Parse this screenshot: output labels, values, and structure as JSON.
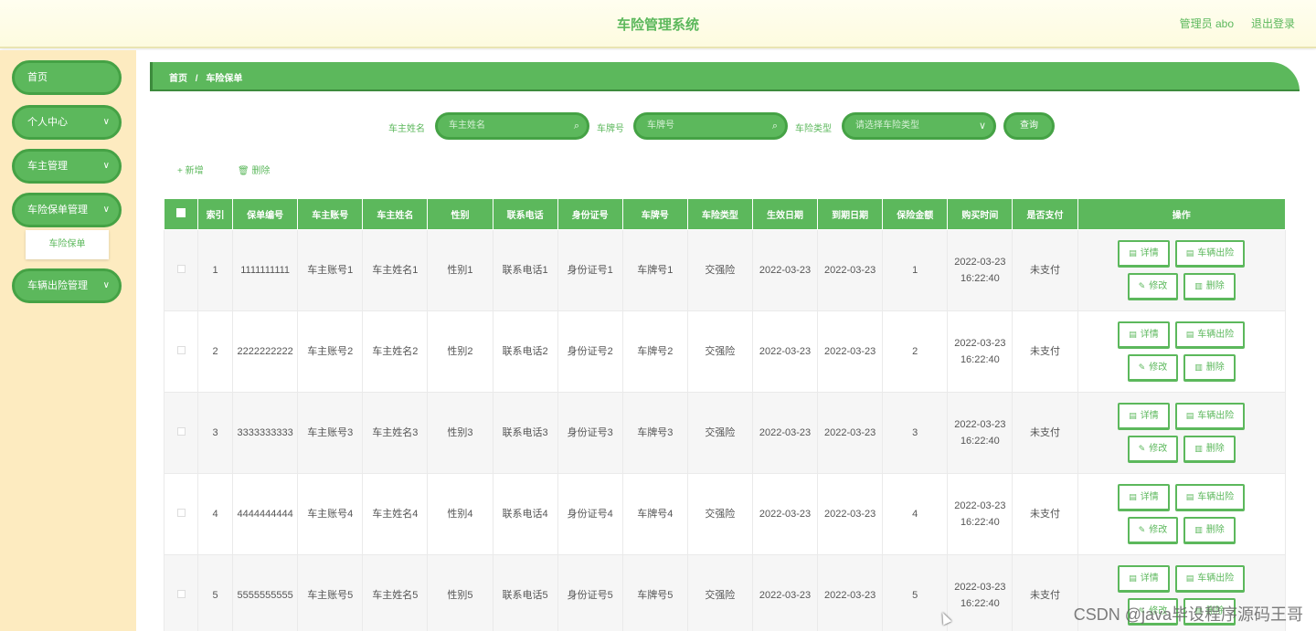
{
  "header": {
    "title": "车险管理系统",
    "admin": "管理员 abo",
    "logout": "退出登录"
  },
  "sidebar": {
    "items": [
      {
        "label": "首页"
      },
      {
        "label": "个人中心"
      },
      {
        "label": "车主管理"
      },
      {
        "label": "车险保单管理"
      },
      {
        "label": "车辆出险管理"
      }
    ],
    "sub_active": "车险保单"
  },
  "breadcrumb": {
    "home": "首页",
    "sep": "/",
    "current": "车险保单"
  },
  "search": {
    "owner_label": "车主姓名",
    "owner_placeholder": "车主姓名",
    "plate_label": "车牌号",
    "plate_placeholder": "车牌号",
    "type_label": "车险类型",
    "type_placeholder": "请选择车险类型",
    "query": "查询"
  },
  "toolbar": {
    "add": "新增",
    "delete": "删除"
  },
  "table": {
    "headers": [
      "索引",
      "保单编号",
      "车主账号",
      "车主姓名",
      "性别",
      "联系电话",
      "身份证号",
      "车牌号",
      "车险类型",
      "生效日期",
      "到期日期",
      "保险金额",
      "购买时间",
      "是否支付",
      "操作"
    ],
    "actions": {
      "detail": "详情",
      "claim": "车辆出险",
      "edit": "修改",
      "remove": "删除"
    },
    "rows": [
      [
        "1",
        "1111111111",
        "车主账号1",
        "车主姓名1",
        "性别1",
        "联系电话1",
        "身份证号1",
        "车牌号1",
        "交强险",
        "2022-03-23",
        "2022-03-23",
        "1",
        "2022-03-23 16:22:40",
        "未支付"
      ],
      [
        "2",
        "2222222222",
        "车主账号2",
        "车主姓名2",
        "性别2",
        "联系电话2",
        "身份证号2",
        "车牌号2",
        "交强险",
        "2022-03-23",
        "2022-03-23",
        "2",
        "2022-03-23 16:22:40",
        "未支付"
      ],
      [
        "3",
        "3333333333",
        "车主账号3",
        "车主姓名3",
        "性别3",
        "联系电话3",
        "身份证号3",
        "车牌号3",
        "交强险",
        "2022-03-23",
        "2022-03-23",
        "3",
        "2022-03-23 16:22:40",
        "未支付"
      ],
      [
        "4",
        "4444444444",
        "车主账号4",
        "车主姓名4",
        "性别4",
        "联系电话4",
        "身份证号4",
        "车牌号4",
        "交强险",
        "2022-03-23",
        "2022-03-23",
        "4",
        "2022-03-23 16:22:40",
        "未支付"
      ],
      [
        "5",
        "5555555555",
        "车主账号5",
        "车主姓名5",
        "性别5",
        "联系电话5",
        "身份证号5",
        "车牌号5",
        "交强险",
        "2022-03-23",
        "2022-03-23",
        "5",
        "2022-03-23 16:22:40",
        "未支付"
      ]
    ]
  },
  "watermark": "CSDN @java毕设程序源码王哥",
  "colors": {
    "accent": "#5cb85c",
    "sidebar_bg": "#fdebc0",
    "header_bg": "#fffef0"
  }
}
